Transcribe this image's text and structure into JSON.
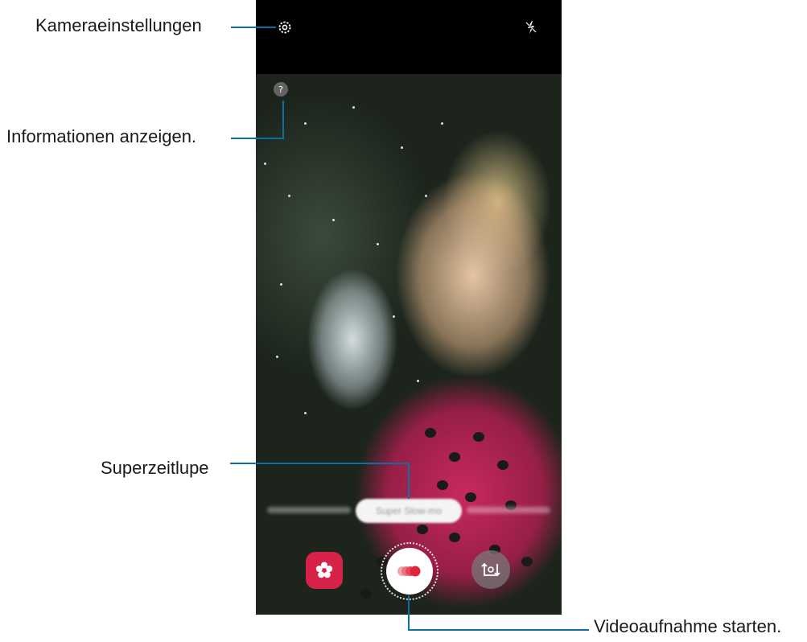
{
  "callouts": {
    "settings": "Kameraeinstellungen",
    "info": "Informationen anzeigen.",
    "mode": "Superzeitlupe",
    "record": "Videoaufnahme starten."
  },
  "camera": {
    "info_button": "?",
    "mode_chip_label": "Super Slow-mo"
  },
  "icons": {
    "settings": "gear-icon",
    "flash": "flash-off-icon",
    "info": "question-icon",
    "bixby": "flower-icon",
    "record": "super-slow-mo-record-icon",
    "switch": "switch-camera-icon"
  },
  "colors": {
    "callout_line": "#0a6fa3",
    "bixby_bg": "#d62148",
    "record_accent": "#e0243c"
  }
}
